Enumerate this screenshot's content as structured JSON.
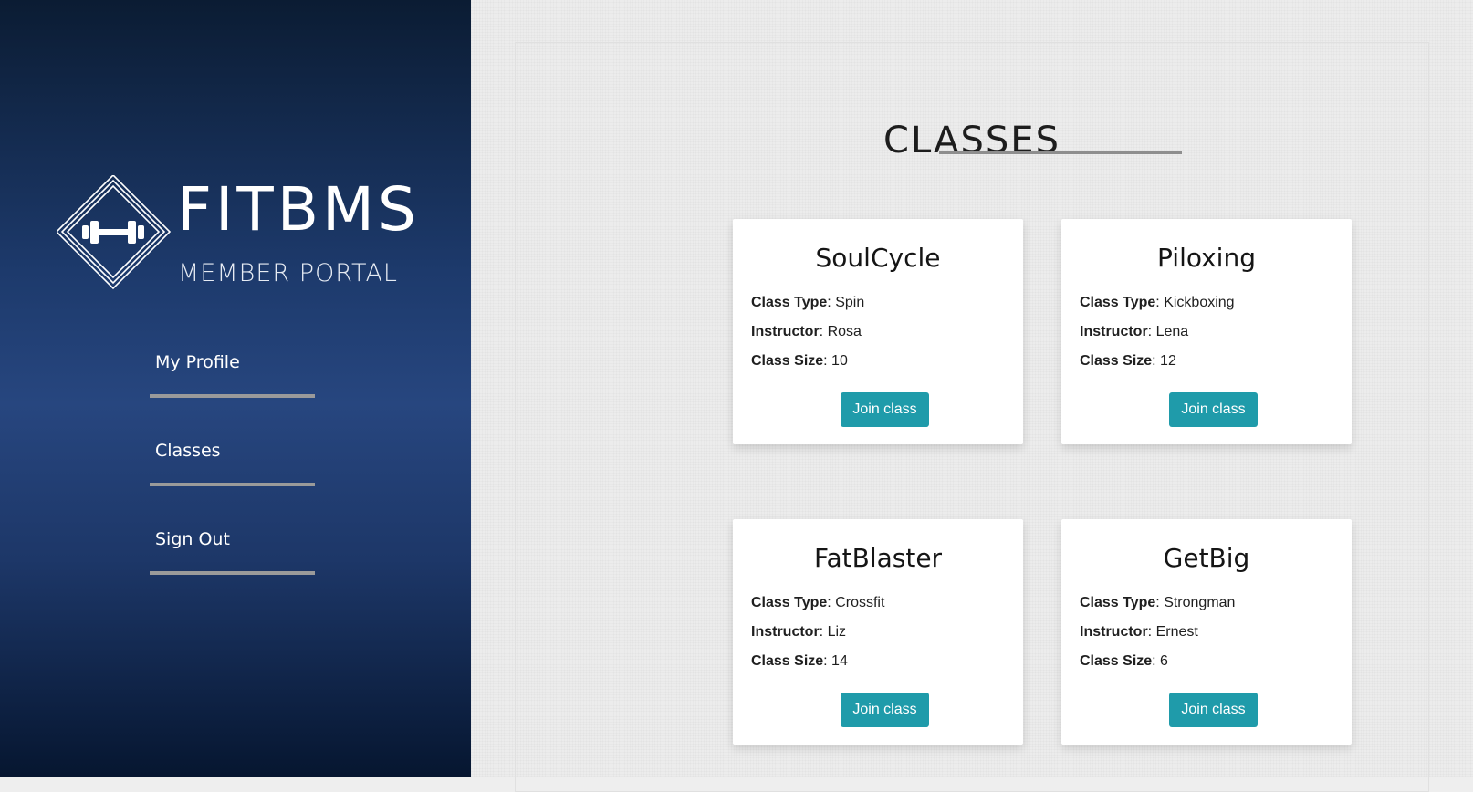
{
  "brand": {
    "title": "FITBMS",
    "subtitle": "MEMBER PORTAL",
    "logo_icon": "dumbbell-diamond-icon"
  },
  "nav": {
    "items": [
      {
        "label": "My Profile"
      },
      {
        "label": "Classes"
      },
      {
        "label": "Sign Out"
      }
    ]
  },
  "colors": {
    "sidebar": "#1d3a6c",
    "button": "#1f9baa",
    "rule": "#9a9a9a"
  },
  "main": {
    "title": "CLASSES",
    "field_labels": {
      "type": "Class Type",
      "instructor": "Instructor",
      "size": "Class Size"
    },
    "join_label": "Join class",
    "classes": [
      {
        "name": "SoulCycle",
        "type": ": Spin",
        "instructor": ": Rosa",
        "size": ": 10"
      },
      {
        "name": "Piloxing",
        "type": ": Kickboxing",
        "instructor": ": Lena",
        "size": ": 12"
      },
      {
        "name": "FatBlaster",
        "type": ": Crossfit",
        "instructor": ": Liz",
        "size": ": 14"
      },
      {
        "name": "GetBig",
        "type": ": Strongman",
        "instructor": ": Ernest",
        "size": ": 6"
      }
    ]
  }
}
